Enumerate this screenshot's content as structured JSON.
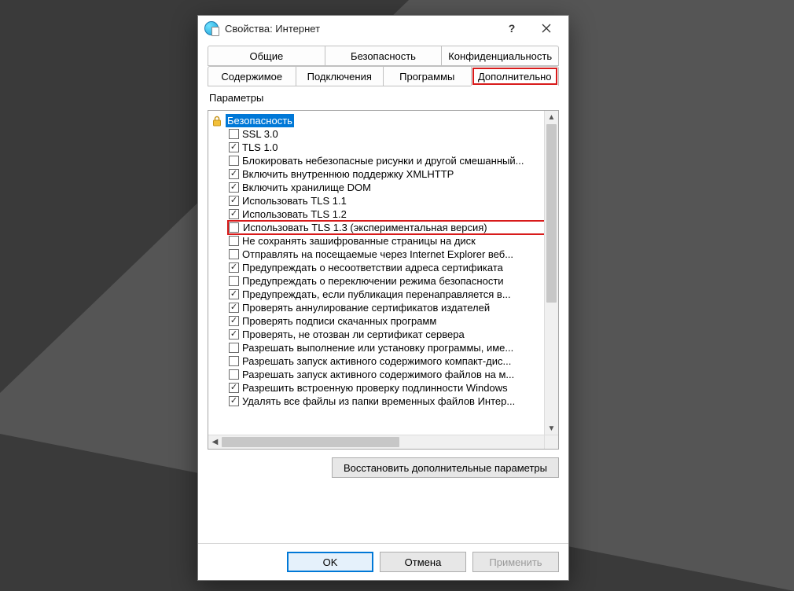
{
  "window": {
    "title": "Свойства: Интернет"
  },
  "tabs_row1": [
    {
      "label": "Общие"
    },
    {
      "label": "Безопасность"
    },
    {
      "label": "Конфиденциальность"
    }
  ],
  "tabs_row2": [
    {
      "label": "Содержимое"
    },
    {
      "label": "Подключения"
    },
    {
      "label": "Программы"
    },
    {
      "label": "Дополнительно",
      "active": true,
      "highlight": true
    }
  ],
  "groupbox": {
    "label": "Параметры"
  },
  "tree": {
    "category": {
      "icon": "lock-icon",
      "label": "Безопасность"
    },
    "items": [
      {
        "checked": false,
        "label": "SSL 3.0"
      },
      {
        "checked": true,
        "label": "TLS 1.0"
      },
      {
        "checked": false,
        "label": "Блокировать небезопасные рисунки и другой смешанный..."
      },
      {
        "checked": true,
        "label": "Включить внутреннюю поддержку XMLHTTP"
      },
      {
        "checked": true,
        "label": "Включить хранилище DOM"
      },
      {
        "checked": true,
        "label": "Использовать TLS 1.1"
      },
      {
        "checked": true,
        "label": "Использовать TLS 1.2"
      },
      {
        "checked": false,
        "label": "Использовать TLS 1.3 (экспериментальная версия)",
        "highlight": true
      },
      {
        "checked": false,
        "label": "Не сохранять зашифрованные страницы на диск"
      },
      {
        "checked": false,
        "label": "Отправлять на посещаемые через Internet Explorer веб..."
      },
      {
        "checked": true,
        "label": "Предупреждать о несоответствии адреса сертификата"
      },
      {
        "checked": false,
        "label": "Предупреждать о переключении режима безопасности"
      },
      {
        "checked": true,
        "label": "Предупреждать, если публикация перенаправляется в..."
      },
      {
        "checked": true,
        "label": "Проверять аннулирование сертификатов издателей"
      },
      {
        "checked": true,
        "label": "Проверять подписи скачанных программ"
      },
      {
        "checked": true,
        "label": "Проверять, не отозван ли сертификат сервера"
      },
      {
        "checked": false,
        "label": "Разрешать выполнение или установку программы, име..."
      },
      {
        "checked": false,
        "label": "Разрешать запуск активного содержимого компакт-дис..."
      },
      {
        "checked": false,
        "label": "Разрешать запуск активного содержимого файлов на м..."
      },
      {
        "checked": true,
        "label": "Разрешить встроенную проверку подлинности Windows"
      },
      {
        "checked": true,
        "label": "Удалять все файлы из папки временных файлов Интер..."
      }
    ]
  },
  "buttons": {
    "restore": "Восстановить дополнительные параметры",
    "ok": "OK",
    "cancel": "Отмена",
    "apply": "Применить"
  }
}
